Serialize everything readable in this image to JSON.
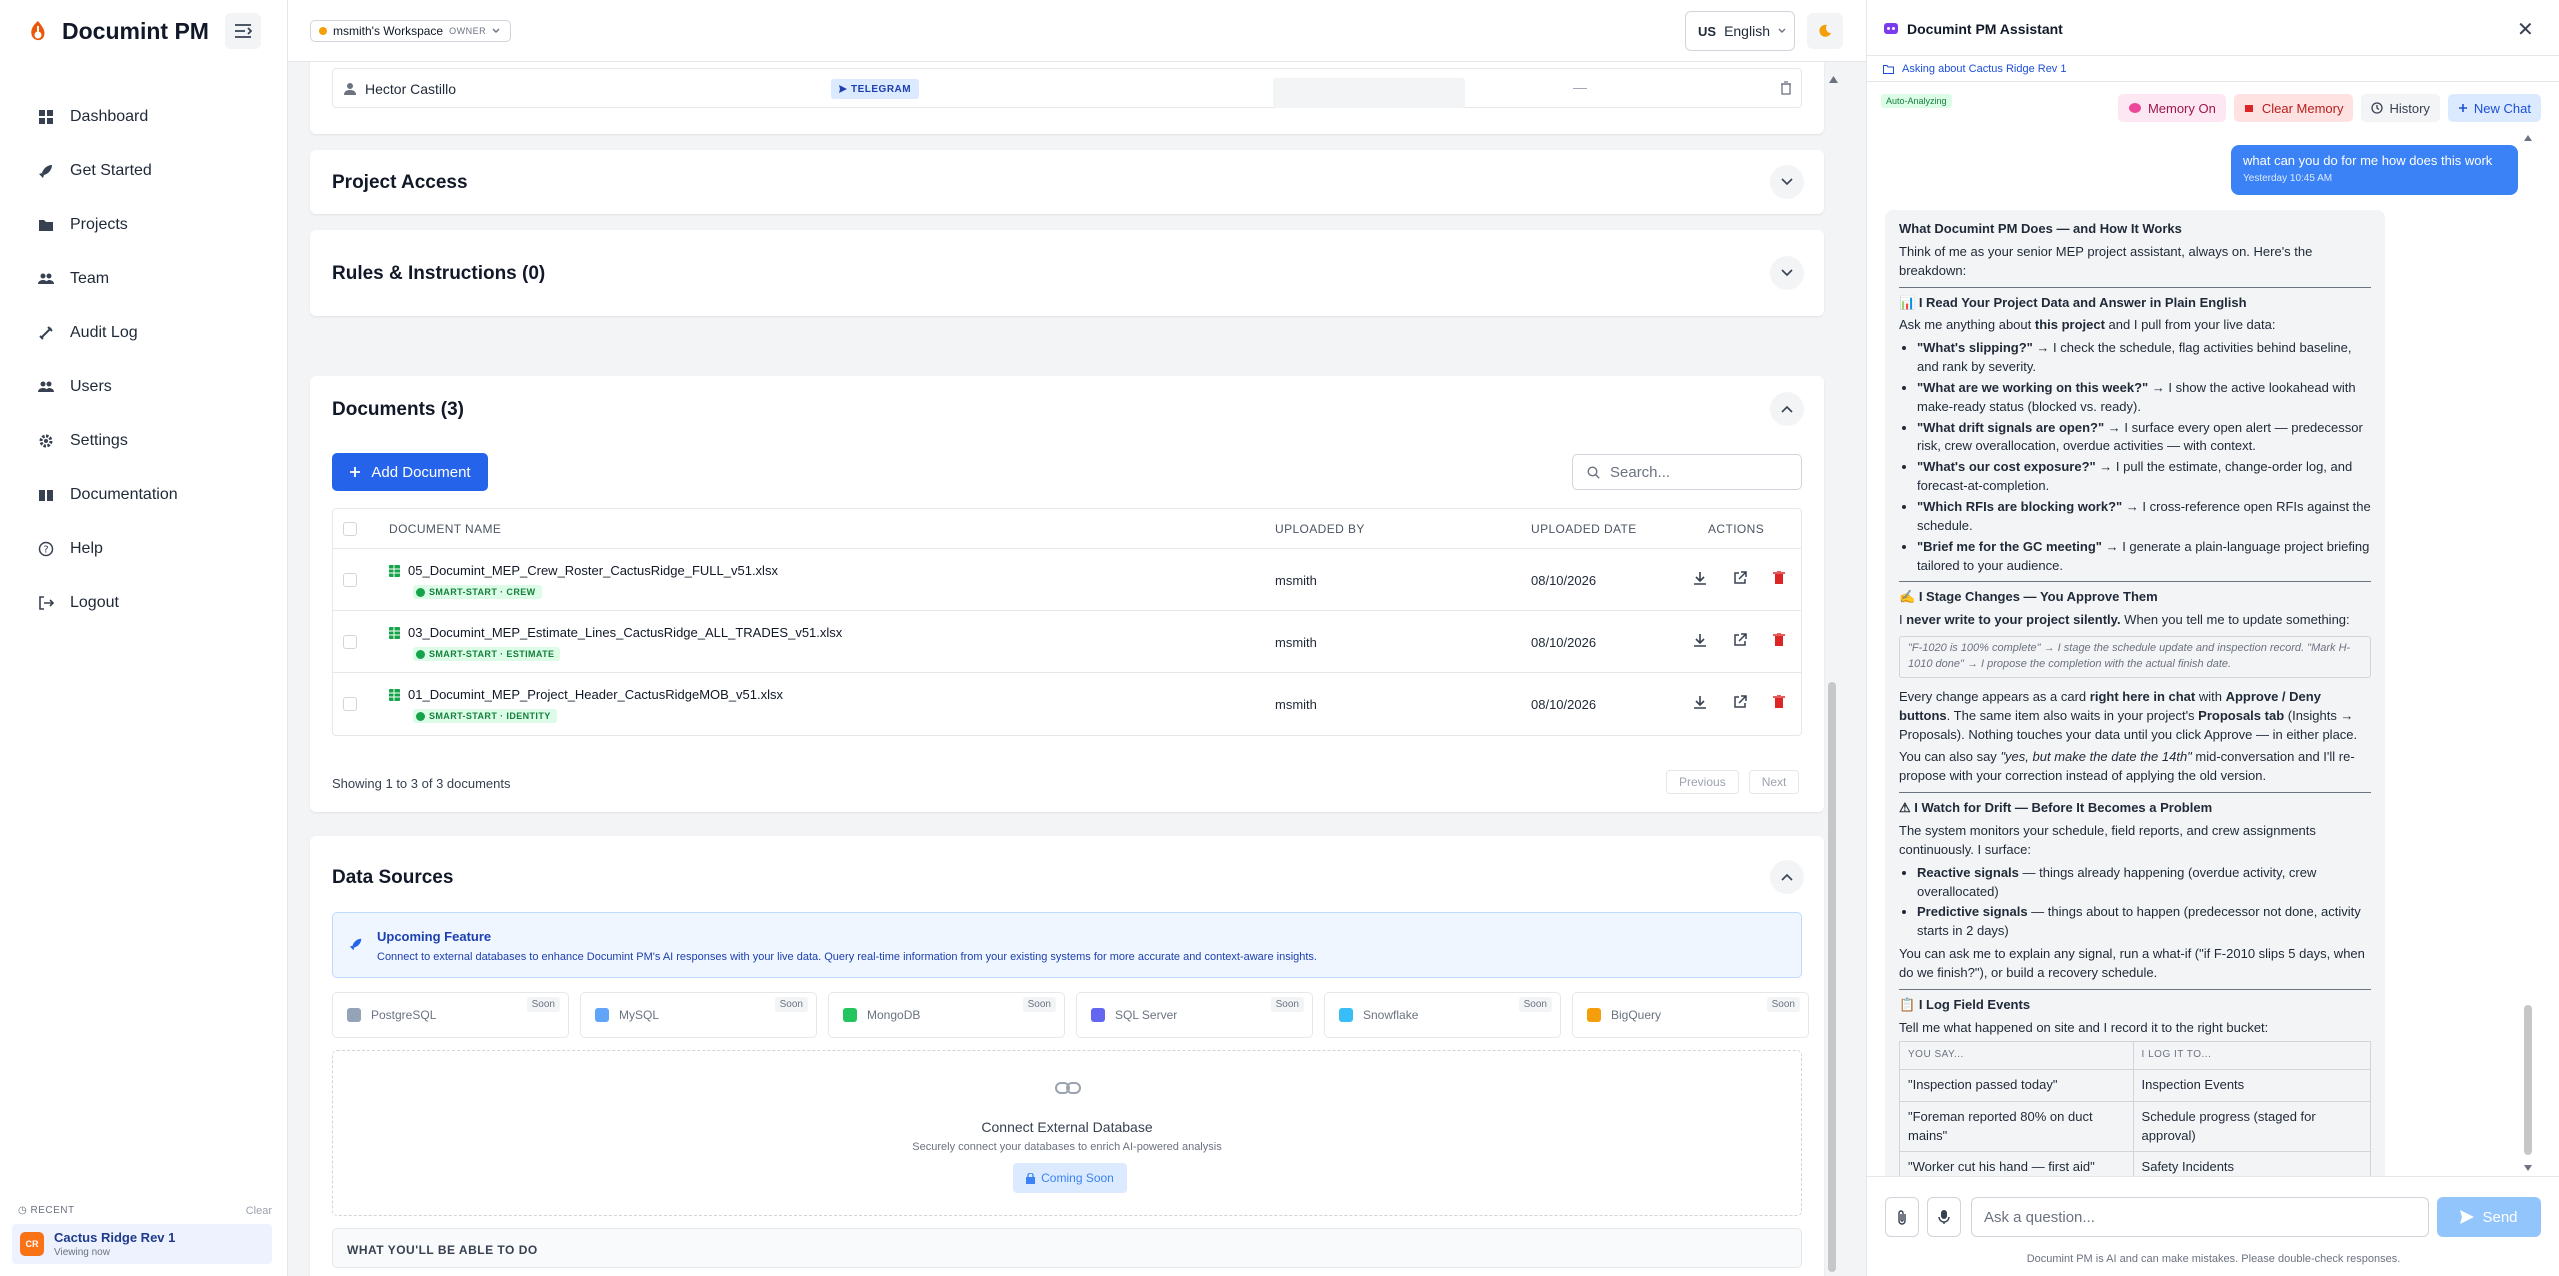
{
  "app": {
    "name": "Documint PM"
  },
  "sidebar": {
    "items": [
      {
        "label": "Dashboard",
        "icon": "dashboard-icon"
      },
      {
        "label": "Get Started",
        "icon": "rocket-icon"
      },
      {
        "label": "Projects",
        "icon": "folder-icon"
      },
      {
        "label": "Team",
        "icon": "team-icon"
      },
      {
        "label": "Audit Log",
        "icon": "audit-icon"
      },
      {
        "label": "Users",
        "icon": "users-icon"
      },
      {
        "label": "Settings",
        "icon": "gear-icon"
      },
      {
        "label": "Documentation",
        "icon": "book-icon"
      },
      {
        "label": "Help",
        "icon": "help-icon"
      },
      {
        "label": "Logout",
        "icon": "logout-icon"
      }
    ],
    "recent": {
      "label": "RECENT",
      "clear": "Clear",
      "avatar": "CR",
      "item_title": "Cactus Ridge Rev 1",
      "item_sub": "Viewing now"
    }
  },
  "topbar": {
    "workspace": "msmith's Workspace",
    "role": "OWNER",
    "lang_code": "US",
    "lang": "English"
  },
  "member": {
    "name": "Hector Castillo",
    "channel": "TELEGRAM",
    "dash": "—"
  },
  "sections": {
    "project_access": "Project Access",
    "rules": "Rules & Instructions (0)",
    "documents": "Documents (3)",
    "data_sources": "Data Sources"
  },
  "documents": {
    "add_label": "Add Document",
    "search_placeholder": "Search...",
    "columns": [
      "DOCUMENT NAME",
      "UPLOADED BY",
      "UPLOADED DATE",
      "ACTIONS"
    ],
    "rows": [
      {
        "name": "05_Documint_MEP_Crew_Roster_CactusRidge_FULL_v51.xlsx",
        "tag": "SMART-START · CREW",
        "by": "msmith",
        "date": "08/10/2026"
      },
      {
        "name": "03_Documint_MEP_Estimate_Lines_CactusRidge_ALL_TRADES_v51.xlsx",
        "tag": "SMART-START · ESTIMATE",
        "by": "msmith",
        "date": "08/10/2026"
      },
      {
        "name": "01_Documint_MEP_Project_Header_CactusRidgeMOB_v51.xlsx",
        "tag": "SMART-START · IDENTITY",
        "by": "msmith",
        "date": "08/10/2026"
      }
    ],
    "showing": "Showing 1 to 3 of 3 documents",
    "prev": "Previous",
    "next": "Next"
  },
  "data_sources": {
    "feature_title": "Upcoming Feature",
    "feature_desc": "Connect to external databases to enhance Documint PM's AI responses with your live data. Query real-time information from your existing systems for more accurate and context-aware insights.",
    "databases": [
      {
        "name": "PostgreSQL",
        "soon": "Soon",
        "color": "#94a3b8"
      },
      {
        "name": "MySQL",
        "soon": "Soon",
        "color": "#60a5fa"
      },
      {
        "name": "MongoDB",
        "soon": "Soon",
        "color": "#22c55e"
      },
      {
        "name": "SQL Server",
        "soon": "Soon",
        "color": "#6366f1"
      },
      {
        "name": "Snowflake",
        "soon": "Soon",
        "color": "#38bdf8"
      },
      {
        "name": "BigQuery",
        "soon": "Soon",
        "color": "#f59e0b"
      }
    ],
    "connect_title": "Connect External Database",
    "connect_desc": "Securely connect your databases to enrich AI-powered analysis",
    "coming_soon": "Coming Soon",
    "able_title": "WHAT YOU'LL BE ABLE TO DO"
  },
  "assistant": {
    "title": "Documint PM Assistant",
    "context": "Asking about Cactus Ridge Rev 1",
    "auto": "Auto-Analyzing",
    "memory": "Memory On",
    "clear_memory": "Clear Memory",
    "history": "History",
    "new_chat": "New Chat",
    "user_msg": "what can you do for me how does this work",
    "user_time": "Yesterday 10:45 AM",
    "input_placeholder": "Ask a question...",
    "send": "Send",
    "disclaimer": "Documint PM is AI and can make mistakes. Please double-check responses.",
    "table_head": [
      "YOU SAY...",
      "I LOG IT TO..."
    ],
    "table_rows": [
      [
        "\"Inspection passed today\"",
        "Inspection Events"
      ],
      [
        "\"Foreman reported 80% on duct mains\"",
        "Schedule progress (staged for approval)"
      ],
      [
        "\"Worker cut his hand — first aid\"",
        "Safety Incidents"
      ]
    ]
  }
}
